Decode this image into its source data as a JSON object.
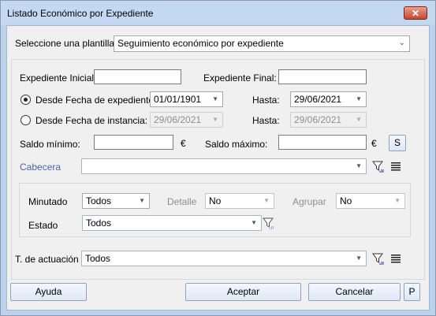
{
  "window": {
    "title": "Listado Económico por Expediente",
    "close_glyph": "✕"
  },
  "plantilla": {
    "label": "Seleccione una plantilla:",
    "value": "Seguimiento económico por expediente"
  },
  "expediente": {
    "inicial_label": "Expediente Inicial:",
    "inicial_value": "",
    "final_label": "Expediente Final:",
    "final_value": ""
  },
  "fecha_expediente": {
    "label": "Desde Fecha de expediente:",
    "desde": "01/01/1901",
    "hasta_label": "Hasta:",
    "hasta": "29/06/2021",
    "selected": true
  },
  "fecha_instancia": {
    "label": "Desde Fecha de instancia:",
    "desde": "29/06/2021",
    "hasta_label": "Hasta:",
    "hasta": "29/06/2021",
    "selected": false
  },
  "saldo": {
    "minimo_label": "Saldo mínimo:",
    "minimo_value": "",
    "maximo_label": "Saldo máximo:",
    "maximo_value": "",
    "currency": "€",
    "s_button": "S"
  },
  "cabecera": {
    "label": "Cabecera",
    "value": ""
  },
  "minutado": {
    "label": "Minutado",
    "value": "Todos"
  },
  "detalle": {
    "label": "Detalle",
    "value": "No"
  },
  "agrupar": {
    "label": "Agrupar",
    "value": "No"
  },
  "estado": {
    "label": "Estado",
    "value": "Todos"
  },
  "actuacion": {
    "label": "T. de actuación",
    "value": "Todos"
  },
  "buttons": {
    "ayuda": "Ayuda",
    "aceptar": "Aceptar",
    "cancelar": "Cancelar",
    "p": "P"
  }
}
